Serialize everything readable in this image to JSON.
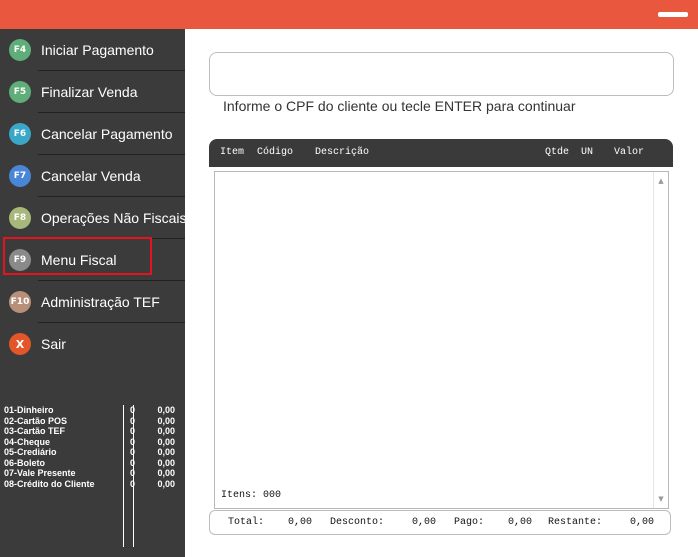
{
  "menu": [
    {
      "key": "F4",
      "label": "Iniciar Pagamento",
      "color": "#5fae7a"
    },
    {
      "key": "F5",
      "label": "Finalizar Venda",
      "color": "#5fae7a"
    },
    {
      "key": "F6",
      "label": "Cancelar Pagamento",
      "color": "#3aa6c8"
    },
    {
      "key": "F7",
      "label": "Cancelar Venda",
      "color": "#4a86d8"
    },
    {
      "key": "F8",
      "label": "Operações Não Fiscais",
      "color": "#a8b87a"
    },
    {
      "key": "F9",
      "label": "Menu Fiscal",
      "color": "#8a8a8a"
    },
    {
      "key": "F10",
      "label": "Administração TEF",
      "color": "#b8907a"
    },
    {
      "key": "X",
      "label": "Sair",
      "color": "#e2562a"
    }
  ],
  "payments": [
    {
      "name": "01-Dinheiro",
      "qty": "0",
      "value": "0,00"
    },
    {
      "name": "02-Cartão POS",
      "qty": "0",
      "value": "0,00"
    },
    {
      "name": "03-Cartão TEF",
      "qty": "0",
      "value": "0,00"
    },
    {
      "name": "04-Cheque",
      "qty": "0",
      "value": "0,00"
    },
    {
      "name": "05-Crediário",
      "qty": "0",
      "value": "0,00"
    },
    {
      "name": "06-Boleto",
      "qty": "0",
      "value": "0,00"
    },
    {
      "name": "07-Vale Presente",
      "qty": "0",
      "value": "0,00"
    },
    {
      "name": "08-Crédito do Cliente",
      "qty": "0",
      "value": "0,00"
    }
  ],
  "cpf": {
    "value": "",
    "hint": "Informe o CPF do cliente ou tecle ENTER para continuar"
  },
  "table": {
    "col_item": "Item",
    "col_code": "Código",
    "col_desc": "Descrição",
    "col_qty": "Qtde",
    "col_un": "UN",
    "col_value": "Valor"
  },
  "items_count": "Itens: 000",
  "totals": {
    "total_label": "Total:",
    "total_value": "0,00",
    "discount_label": "Desconto:",
    "discount_value": "0,00",
    "paid_label": "Pago:",
    "paid_value": "0,00",
    "remaining_label": "Restante:",
    "remaining_value": "0,00"
  }
}
